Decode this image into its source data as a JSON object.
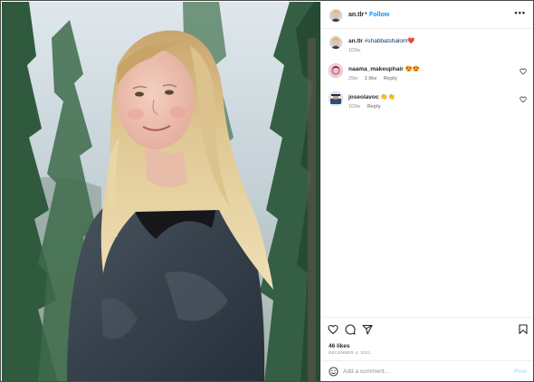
{
  "post": {
    "username": "an.tlr",
    "dot": "•",
    "follow_label": "Follow",
    "more_label": "•••"
  },
  "caption": {
    "username": "an.tlr",
    "hashtag": "#shabbatshalom",
    "emoji": "❤️",
    "time": "103w"
  },
  "comments": [
    {
      "username": "naama_makeuphair",
      "text": "😍😍",
      "time": "29w",
      "likes": "1 like",
      "reply": "Reply"
    },
    {
      "username": "joseolavoc",
      "text": "👏👏",
      "time": "103w",
      "reply": "Reply"
    }
  ],
  "stats": {
    "likes": "46 likes",
    "date": "DECEMBER 4, 2021"
  },
  "add_comment": {
    "placeholder": "Add a comment…",
    "post_label": "Post"
  },
  "icons": {
    "like": "heart-icon",
    "comment": "comment-bubble-icon",
    "share": "paper-plane-icon",
    "save": "bookmark-icon",
    "emoji": "smiley-icon",
    "comment_like": "small-heart-icon"
  },
  "colors": {
    "link": "#0095f6",
    "hashtag": "#00376b",
    "muted": "#8e8e8e",
    "post_disabled": "#b2dffc"
  }
}
